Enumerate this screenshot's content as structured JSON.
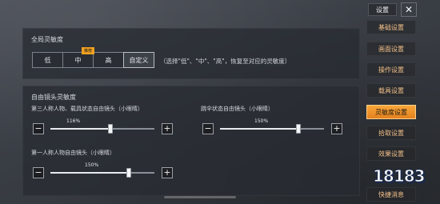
{
  "sidebar": {
    "title": "设置",
    "close_glyph": "✕",
    "items": [
      {
        "label": "基础设置",
        "active": false
      },
      {
        "label": "画面设置",
        "active": false
      },
      {
        "label": "操作设置",
        "active": false
      },
      {
        "label": "载具设置",
        "active": false
      },
      {
        "label": "灵敏度设置",
        "active": true
      },
      {
        "label": "拾取设置",
        "active": false
      },
      {
        "label": "效果设置",
        "active": false
      },
      {
        "label": "快捷消息",
        "active": false
      }
    ]
  },
  "global_sensitivity": {
    "title": "全局灵敏度",
    "options": [
      "低",
      "中",
      "高",
      "自定义"
    ],
    "selected": "自定义",
    "recommended_badge": "推荐",
    "hint": "（选择\"低\"、\"中\"、\"高\"，恢复至对应的灵敏度）"
  },
  "free_camera": {
    "title": "自由镜头灵敏度",
    "sliders": [
      {
        "label": "第三人称人物、载具状态自由镜头（小眼睛）",
        "value": "116%",
        "level": 0.58
      },
      {
        "label": "跳伞状态自由镜头（小眼睛）",
        "value": "150%",
        "level": 0.75
      },
      {
        "label": "第一人称人物自由镜头（小眼睛）",
        "value": "150%",
        "level": 0.75
      }
    ],
    "minus_glyph": "−",
    "plus_glyph": "+"
  },
  "watermark": "18183",
  "colors": {
    "accent": "#f0a020",
    "sidebar_text": "#f3c08a"
  }
}
